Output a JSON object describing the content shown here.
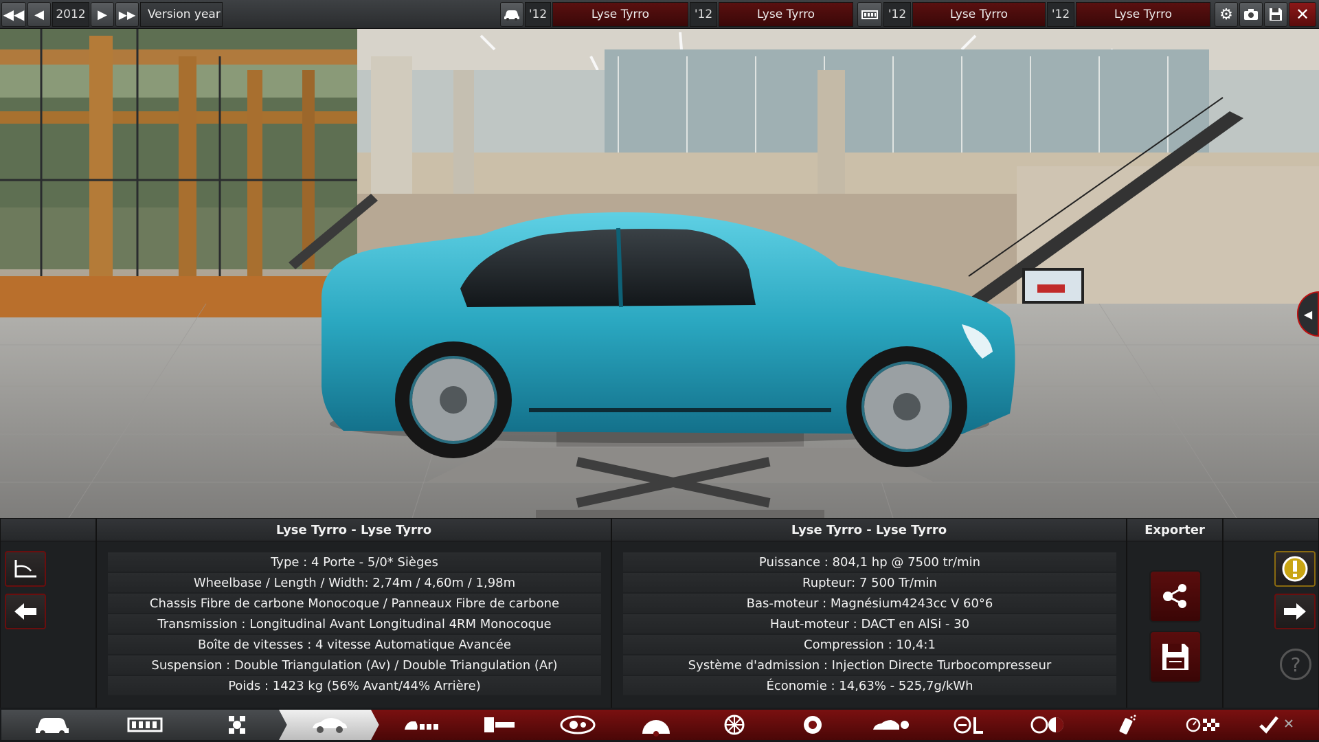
{
  "topbar": {
    "year": "2012",
    "version_label": "Version year",
    "slots": [
      {
        "year": "'12",
        "name": "Lyse Tyrro"
      },
      {
        "year": "'12",
        "name": "Lyse Tyrro"
      },
      {
        "year": "'12",
        "name": "Lyse Tyrro"
      },
      {
        "year": "'12",
        "name": "Lyse Tyrro"
      }
    ]
  },
  "panel": {
    "left_title": "Lyse Tyrro - Lyse Tyrro",
    "right_title": "Lyse Tyrro - Lyse Tyrro",
    "export_label": "Exporter",
    "left_stats": [
      "Type : 4 Porte - 5/0* Sièges",
      "Wheelbase / Length / Width: 2,74m / 4,60m / 1,98m",
      "Chassis Fibre de carbone Monocoque / Panneaux Fibre de carbone",
      "Transmission : Longitudinal Avant Longitudinal 4RM Monocoque",
      "Boîte de vitesses : 4 vitesse Automatique Avancée",
      "Suspension : Double Triangulation (Av) / Double Triangulation (Ar)",
      "Poids : 1423 kg (56% Avant/44% Arrière)"
    ],
    "right_stats": [
      "Puissance : 804,1 hp @ 7500 tr/min",
      "Rupteur: 7 500 Tr/min",
      "Bas-moteur : Magnésium4243cc V 60°6",
      "Haut-moteur : DACT en AlSi - 30",
      "Compression : 10,4:1",
      "Système d'admission : Injection Directe Turbocompresseur",
      "Économie : 14,63% - 525,7g/kWh"
    ]
  },
  "colors": {
    "accent_red": "#7a1010",
    "car_body": "#2fb0c8"
  }
}
